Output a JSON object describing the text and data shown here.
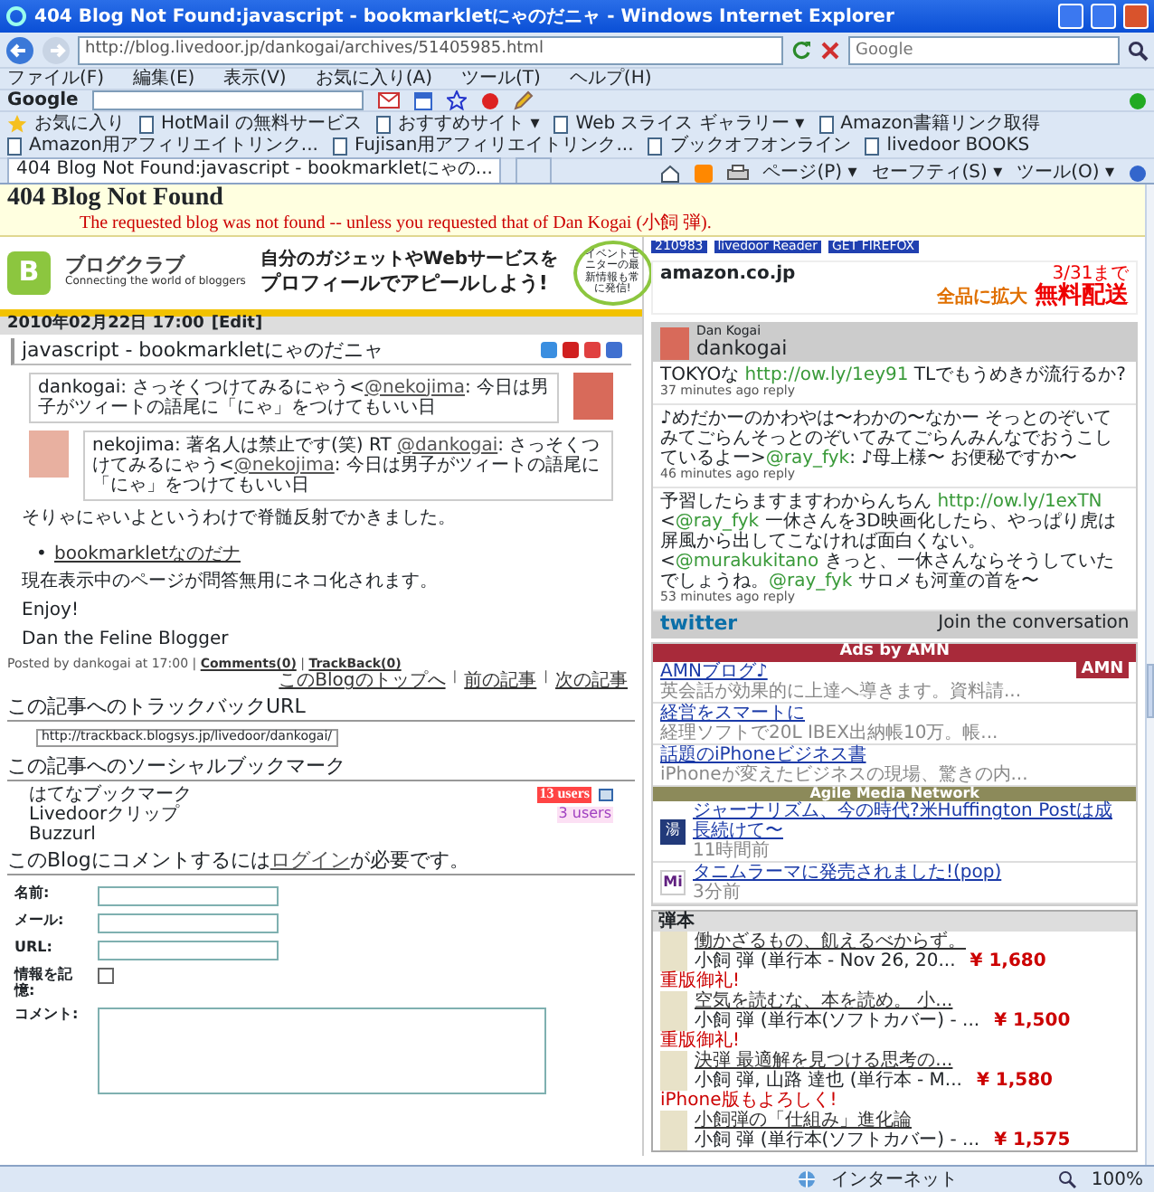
{
  "window": {
    "title": "404 Blog Not Found:javascript - bookmarkletにゃのだニャ - Windows Internet Explorer"
  },
  "address_bar": {
    "url": "http://blog.livedoor.jp/dankogai/archives/51405985.html",
    "search_placeholder": "Google"
  },
  "menu": [
    "ファイル(F)",
    "編集(E)",
    "表示(V)",
    "お気に入り(A)",
    "ツール(T)",
    "ヘルプ(H)"
  ],
  "google_toolbar": {
    "logo": "Google"
  },
  "favorites_bar": {
    "label": "お気に入り",
    "items": [
      "HotMail の無料サービス",
      "おすすめサイト ▾",
      "Web スライス ギャラリー ▾",
      "Amazon書籍リンク取得",
      "Amazon用アフィリエイトリンク...",
      "Fujisan用アフィリエイトリンク...",
      "ブックオフオンライン",
      "livedoor BOOKS"
    ]
  },
  "tabs": [
    {
      "label": "404 Blog Not Found:javascript - bookmarkletにゃの...",
      "selected": true
    }
  ],
  "command_bar": [
    "ページ(P) ▾",
    "セーフティ(S) ▾",
    "ツール(O) ▾"
  ],
  "blog_header": {
    "title": "404 Blog Not Found",
    "subtitle": "The requested blog was not found -- unless you requested that of Dan Kogai (小飼 弾)."
  },
  "banner": {
    "mark": "B",
    "logo": "ブログクラブ",
    "tagline": "Connecting the world of bloggers",
    "headline_1": "自分のガジェットやWebサービスを",
    "headline_2": "プロフィールでアピールしよう!",
    "badge": "イベントモニターの最新情報も常に発信!"
  },
  "post": {
    "date": "2010年02月22日 17:00",
    "edit": "[Edit]",
    "title": "javascript - bookmarkletにゃのだニャ",
    "tweets": [
      {
        "segments": [
          {
            "kind": "text",
            "text": "dankogai: さっそくつけてみるにゃう<"
          },
          {
            "kind": "link",
            "text": "@nekojima"
          },
          {
            "kind": "text",
            "text": ": 今日は男子がツィートの語尾に「にゃ」をつけてもいい日"
          }
        ]
      },
      {
        "segments": [
          {
            "kind": "text",
            "text": "nekojima: 著名人は禁止です(笑) RT "
          },
          {
            "kind": "link",
            "text": "@dankogai"
          },
          {
            "kind": "text",
            "text": ": さっそくつけてみるにゃう<"
          },
          {
            "kind": "link",
            "text": "@nekojima"
          },
          {
            "kind": "text",
            "text": ": 今日は男子がツィートの語尾に「にゃ」をつけてもいい日"
          }
        ]
      }
    ],
    "body": [
      {
        "kind": "para",
        "text": "そりゃにゃいよというわけで脊髄反射でかきました。"
      },
      {
        "kind": "bullet_link",
        "bullet": "•",
        "text": "bookmarkletなのだナ"
      },
      {
        "kind": "para",
        "text": "現在表示中のページが問答無用にネコ化されます。"
      },
      {
        "kind": "para",
        "text": "Enjoy!"
      },
      {
        "kind": "para",
        "text": "Dan the Feline Blogger"
      }
    ],
    "footer": [
      {
        "kind": "text",
        "text": "Posted by dankogai at 17:00 | "
      },
      {
        "kind": "link",
        "text": "Comments(0)"
      },
      {
        "kind": "text",
        "text": " | "
      },
      {
        "kind": "link",
        "text": "TrackBack(0)"
      }
    ],
    "nav": [
      "このBlogのトップへ",
      "前の記事",
      "次の記事"
    ],
    "nav_separator": "|"
  },
  "trackback": {
    "heading": "この記事へのトラックバックURL",
    "url": "http://trackback.blogsys.jp/livedoor/dankogai/"
  },
  "social": {
    "heading": "この記事へのソーシャルブックマーク",
    "items": [
      {
        "name": "はてなブックマーク",
        "count": "13 users",
        "kind": "hot"
      },
      {
        "name": "Livedoorクリップ",
        "count": "3 users",
        "kind": "mild"
      },
      {
        "name": "Buzzurl",
        "kind": "none"
      }
    ]
  },
  "comment": {
    "heading": [
      {
        "kind": "text",
        "text": "このBlogにコメントするには"
      },
      {
        "kind": "link",
        "text": "ログイン"
      },
      {
        "kind": "text",
        "text": "が必要です。"
      }
    ],
    "fields": [
      {
        "label": "名前:",
        "kind": "text"
      },
      {
        "label": "メール:",
        "kind": "text"
      },
      {
        "label": "URL:",
        "kind": "text"
      },
      {
        "label": "情報を記憶:",
        "kind": "checkbox",
        "checked": false
      },
      {
        "label": "コメント:",
        "kind": "textarea"
      }
    ]
  },
  "badges": [
    "210983",
    "livedoor Reader",
    "GET FIREFOX"
  ],
  "amazon": {
    "logo": "amazon.co.jp",
    "date": "3/31まで",
    "line_1": "全品に拡大",
    "line_2": "無料配送"
  },
  "twitter": {
    "name": "Dan Kogai",
    "handle": "dankogai",
    "footer_logo": "twitter",
    "footer": "Join the conversation",
    "tweets": [
      {
        "segments": [
          {
            "kind": "text",
            "text": "TOKYOな "
          },
          {
            "kind": "link",
            "text": "http://ow.ly/1ey91"
          },
          {
            "kind": "text",
            "text": " TLでもうめきが流行るか?"
          }
        ],
        "meta": "37 minutes ago reply"
      },
      {
        "segments": [
          {
            "kind": "text",
            "text": "♪めだかーのかわやは〜わかの〜なかー そっとのぞいてみてごらんそっとのぞいてみてごらんみんなでおうこしているよー>"
          },
          {
            "kind": "link",
            "text": "@ray_fyk"
          },
          {
            "kind": "text",
            "text": ": ♪母上様〜 お便秘ですか〜"
          }
        ],
        "meta": "46 minutes ago reply"
      },
      {
        "segments": [
          {
            "kind": "text",
            "text": "予習したらますますわからんちん "
          },
          {
            "kind": "link",
            "text": "http://ow.ly/1exTN"
          },
          {
            "kind": "text",
            "text": " <"
          },
          {
            "kind": "link",
            "text": "@ray_fyk"
          },
          {
            "kind": "text",
            "text": " 一休さんを3D映画化したら、やっぱり虎は屏風から出してこなければ面白くない。<"
          },
          {
            "kind": "link",
            "text": "@murakukitano"
          },
          {
            "kind": "text",
            "text": " きっと、一休さんならそうしていたでしょうね。"
          },
          {
            "kind": "link",
            "text": "@ray_fyk"
          },
          {
            "kind": "text",
            "text": " サロメも河童の首を〜"
          }
        ],
        "meta": "53 minutes ago reply"
      }
    ]
  },
  "amn_ads": {
    "heading": "Ads by AMN",
    "logo": "AMN",
    "items": [
      {
        "title": "AMNブログ♪",
        "text": "英会話が効果的に上達へ導きます。資料請..."
      },
      {
        "title": "経営をスマートに",
        "text": "経理ソフトで20L IBEX出納帳10万。帳..."
      },
      {
        "title": "話題のiPhoneビジネス書",
        "text": "iPhoneが変えたビジネスの現場、驚きの内..."
      }
    ]
  },
  "agile_media": {
    "heading": "Agile Media Network",
    "items": [
      {
        "icon": "湯",
        "title": "ジャーナリズム、今の時代?米Huffington Postは成長続けて〜",
        "time": "11時間前"
      },
      {
        "icon": "Mi",
        "title": "タニムラーマに発売されました!(pop)",
        "time": "3分前"
      }
    ]
  },
  "books": {
    "heading": "弾本",
    "items": [
      {
        "title": "働かざるもの、飢えるべからず。",
        "author": "小飼 弾 (単行本 - Nov 26, 20...",
        "price": "¥ 1,680",
        "note": "重版御礼!"
      },
      {
        "title": "空気を読むな、本を読め。 小...",
        "author": "小飼 弾 (単行本(ソフトカバー) - ...",
        "price": "¥ 1,500",
        "note": "重版御礼!"
      },
      {
        "title": "決弾 最適解を見つける思考の...",
        "author": "小飼 弾, 山路 達也 (単行本 - M...",
        "price": "¥ 1,580",
        "note": "iPhone版もよろしく!"
      },
      {
        "title": "小飼弾の「仕組み」進化論",
        "author": "小飼 弾 (単行本(ソフトカバー) - ...",
        "price": "¥ 1,575"
      }
    ]
  },
  "status_bar": {
    "zone": "インターネット",
    "zoom": "100%"
  }
}
